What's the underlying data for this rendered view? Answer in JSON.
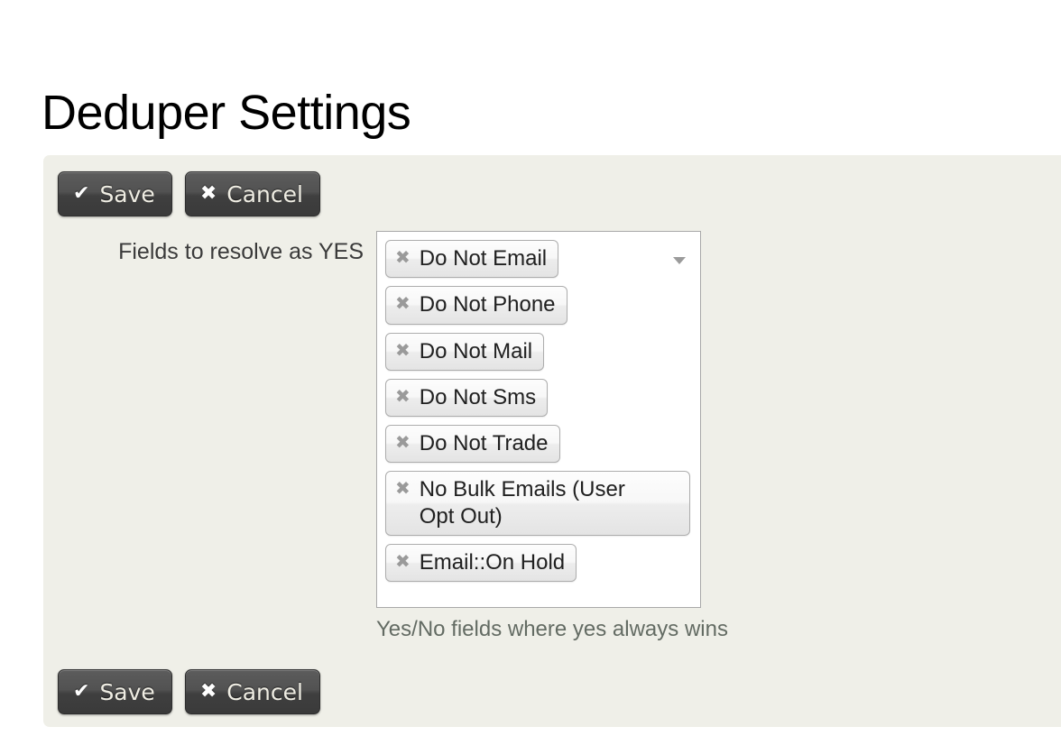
{
  "page": {
    "title": "Deduper Settings",
    "background_color": "#FFFFFF",
    "panel_color": "#EFEFE8"
  },
  "toolbar_top": {
    "save": {
      "label": "Save",
      "glyph": "✔"
    },
    "cancel": {
      "label": "Cancel",
      "glyph": "✖"
    }
  },
  "toolbar_bottom": {
    "save": {
      "label": "Save",
      "glyph": "✔"
    },
    "cancel": {
      "label": "Cancel",
      "glyph": "✖"
    }
  },
  "field": {
    "label": "Fields to resolve as YES",
    "help_text": "Yes/No fields where yes always wins",
    "remove_glyph": "✖",
    "caret_icon": "chevron-down-icon",
    "selected_values": [
      "Do Not Email",
      "Do Not Phone",
      "Do Not Mail",
      "Do Not Sms",
      "Do Not Trade",
      "No Bulk Emails (User Opt Out)",
      "Email::On Hold"
    ]
  },
  "colors": {
    "button_text": "#EFEDE3",
    "chip_border": "#ADADAD",
    "chip_x": "#9A9A9A",
    "help_text": "#636B63",
    "field_border": "#A9A9A9"
  }
}
